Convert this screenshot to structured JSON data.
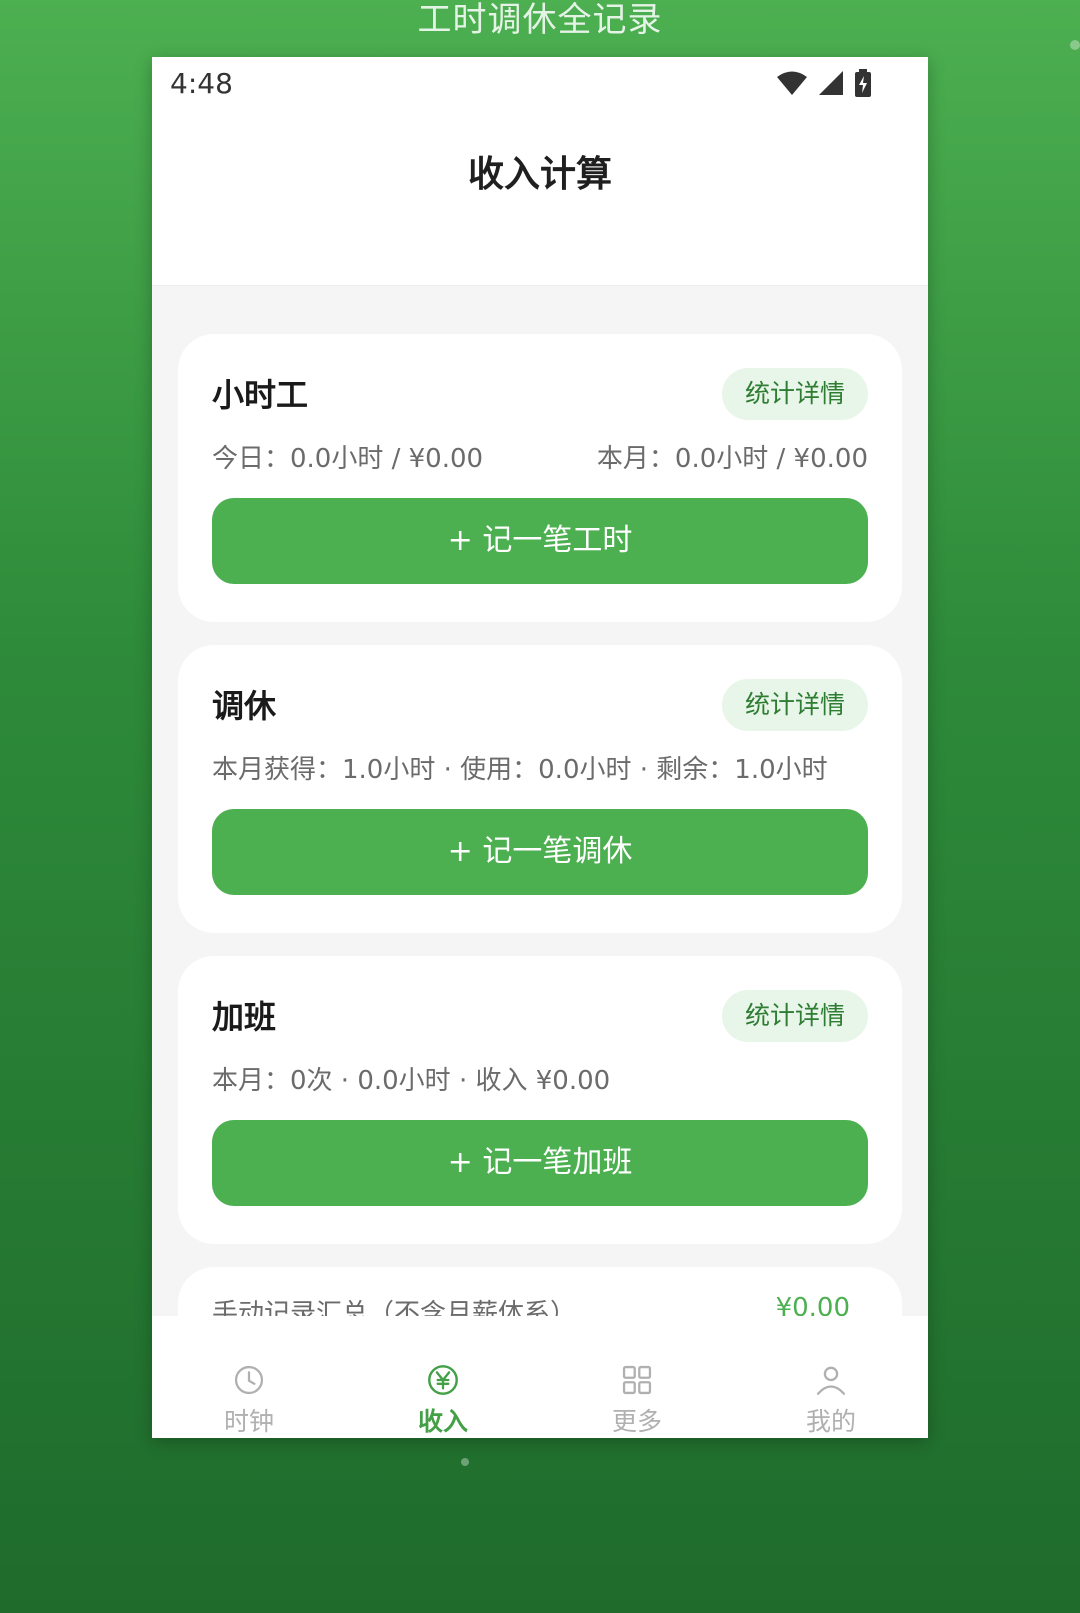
{
  "promo": {
    "title": "工时调休全记录"
  },
  "status_bar": {
    "time": "4:48"
  },
  "app_bar": {
    "title": "收入计算"
  },
  "cards": [
    {
      "title": "小时工",
      "detail_label": "统计详情",
      "stats": [
        "今日：0.0小时 / ¥0.00",
        "本月：0.0小时 / ¥0.00"
      ],
      "action_label": "+ 记一笔工时"
    },
    {
      "title": "调休",
      "detail_label": "统计详情",
      "stats": [
        "本月获得：1.0小时 · 使用：0.0小时 · 剩余：1.0小时"
      ],
      "action_label": "+ 记一笔调休"
    },
    {
      "title": "加班",
      "detail_label": "统计详情",
      "stats": [
        "本月：0次 · 0.0小时 · 收入 ¥0.00"
      ],
      "action_label": "+ 记一笔加班"
    }
  ],
  "summary_card": {
    "title": "手动记录汇总（不含月薪体系）",
    "value": "¥0.00"
  },
  "bottom_nav": [
    {
      "label": "时钟",
      "icon": "clock-icon",
      "active": false
    },
    {
      "label": "收入",
      "icon": "yuan-icon",
      "active": true
    },
    {
      "label": "更多",
      "icon": "grid-icon",
      "active": false
    },
    {
      "label": "我的",
      "icon": "person-icon",
      "active": false
    }
  ],
  "colors": {
    "primary": "#4CAF50",
    "primary_dark": "#2E7D32",
    "chip_bg": "#E8F5E9",
    "inactive": "#B0B0B0"
  }
}
